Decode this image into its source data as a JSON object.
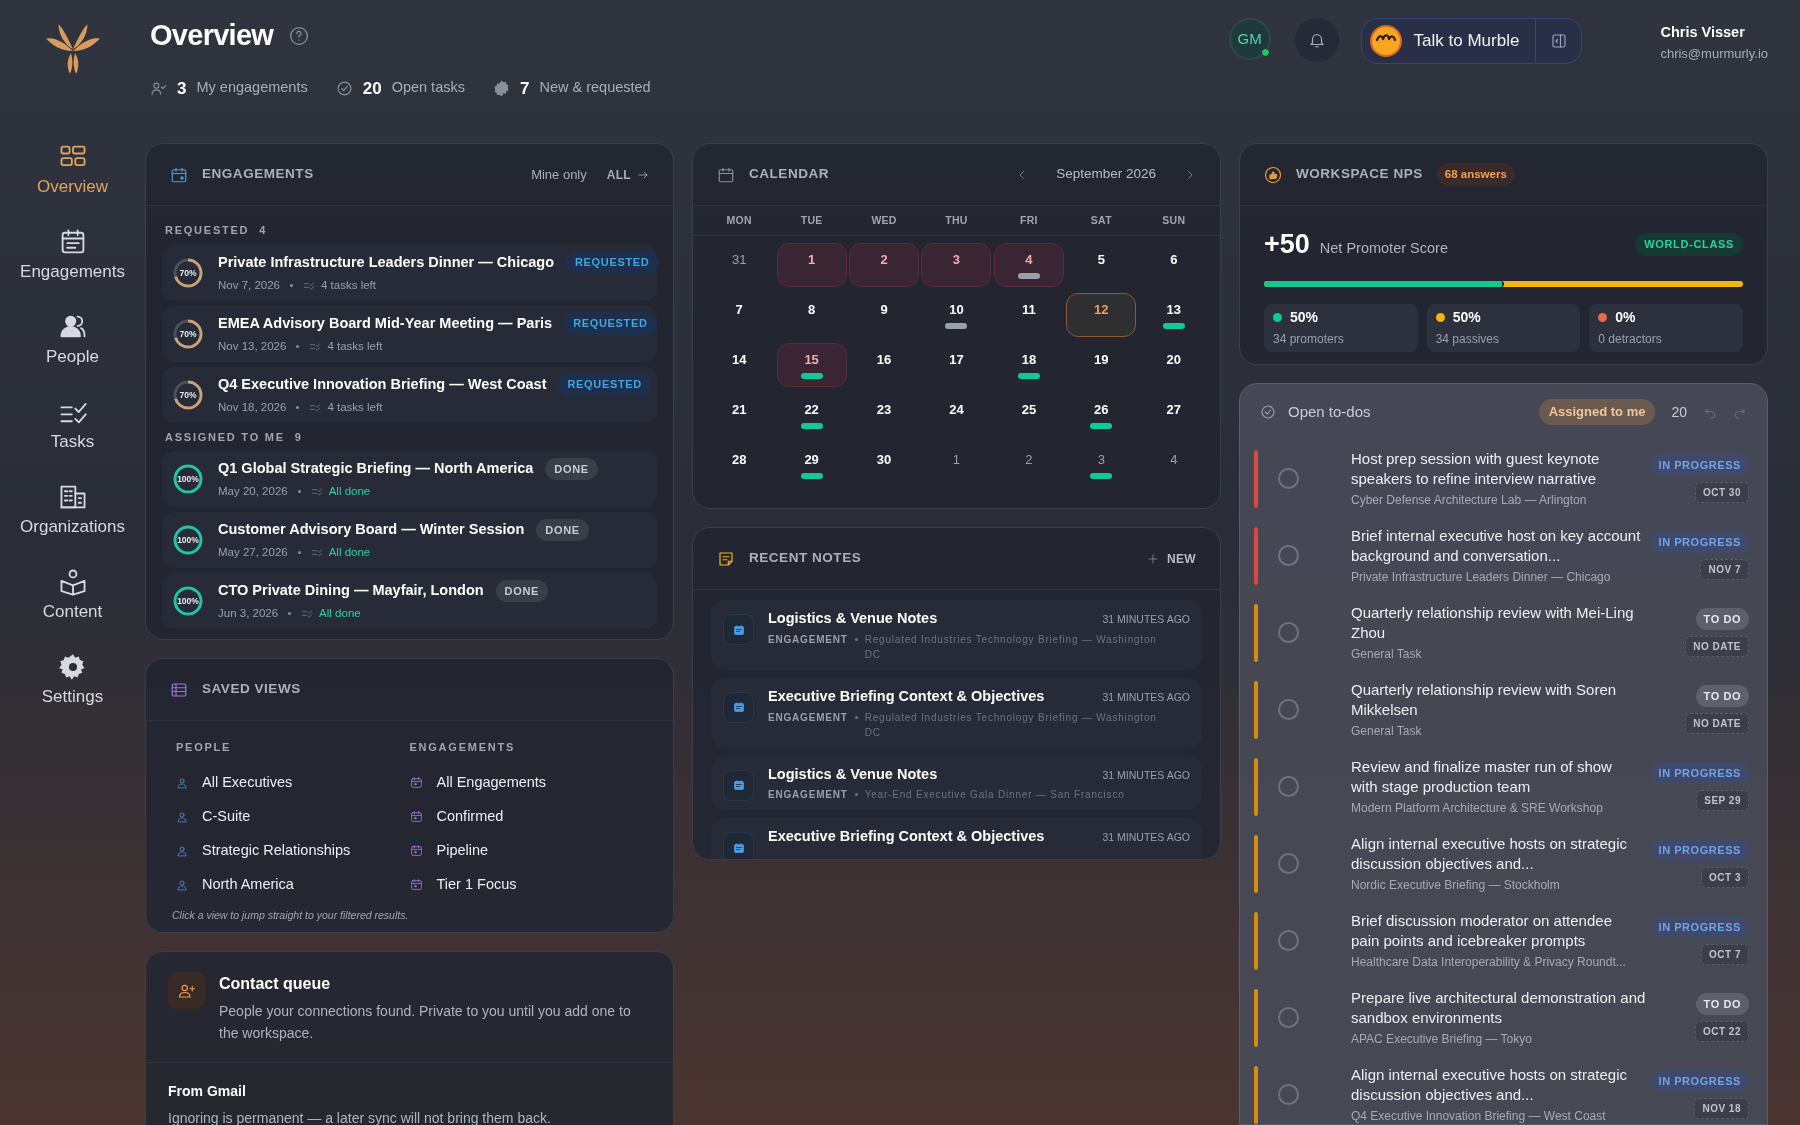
{
  "sidebar": {
    "items": [
      {
        "label": "Overview",
        "selected": true
      },
      {
        "label": "Engagements",
        "selected": false
      },
      {
        "label": "People",
        "selected": false
      },
      {
        "label": "Tasks",
        "selected": false
      },
      {
        "label": "Organizations",
        "selected": false
      },
      {
        "label": "Content",
        "selected": false
      },
      {
        "label": "Settings",
        "selected": false
      }
    ]
  },
  "header": {
    "title": "Overview",
    "stats": [
      {
        "value": "3",
        "label": "My engagements"
      },
      {
        "value": "20",
        "label": "Open tasks"
      },
      {
        "value": "7",
        "label": "New & requested"
      }
    ]
  },
  "topbar": {
    "avatar": "GM",
    "online": true,
    "assistant": "Talk to Murble",
    "user_name": "Chris Visser",
    "user_email": "chris@murmurly.io"
  },
  "engagements": {
    "title": "ENGAGEMENTS",
    "filter": "Mine only",
    "link": "ALL",
    "groups": [
      {
        "label": "REQUESTED",
        "count": "4",
        "items": [
          {
            "title": "Private Infrastructure Leaders Dinner — Chicago",
            "status": "REQUESTED",
            "kind": "requested",
            "progress": "70%",
            "level": 0.7,
            "date": "Nov 7, 2026",
            "tasks": "4 tasks left"
          },
          {
            "title": "EMEA Advisory Board Mid-Year Meeting — Paris",
            "status": "REQUESTED",
            "kind": "requested",
            "progress": "70%",
            "level": 0.7,
            "date": "Nov 13, 2026",
            "tasks": "4 tasks left"
          },
          {
            "title": "Q4 Executive Innovation Briefing — West Coast",
            "status": "REQUESTED",
            "kind": "requested",
            "progress": "70%",
            "level": 0.7,
            "date": "Nov 18, 2026",
            "tasks": "4 tasks left"
          }
        ]
      },
      {
        "label": "ASSIGNED TO ME",
        "count": "9",
        "items": [
          {
            "title": "Q1 Global Strategic Briefing — North America",
            "status": "DONE",
            "kind": "done",
            "progress": "100%",
            "level": 1,
            "date": "May 20, 2026",
            "tasks": "All done"
          },
          {
            "title": "Customer Advisory Board — Winter Session",
            "status": "DONE",
            "kind": "done",
            "progress": "100%",
            "level": 1,
            "date": "May 27, 2026",
            "tasks": "All done"
          },
          {
            "title": "CTO Private Dining — Mayfair, London",
            "status": "DONE",
            "kind": "done",
            "progress": "100%",
            "level": 1,
            "date": "Jun 3, 2026",
            "tasks": "All done"
          }
        ]
      }
    ]
  },
  "saved_views": {
    "title": "SAVED VIEWS",
    "columns": [
      {
        "heading": "PEOPLE",
        "kind": "people",
        "items": [
          "All Executives",
          "C-Suite",
          "Strategic Relationships",
          "North America"
        ]
      },
      {
        "heading": "ENGAGEMENTS",
        "kind": "engagements",
        "items": [
          "All Engagements",
          "Confirmed",
          "Pipeline",
          "Tier 1 Focus"
        ]
      }
    ],
    "hint": "Click a view to jump straight to your filtered results."
  },
  "contact_queue": {
    "title": "Contact queue",
    "description": "People your connections found. Private to you until you add one to the workspace.",
    "section_title": "From Gmail",
    "section_text": "Ignoring is permanent — a later sync will not bring them back."
  },
  "calendar": {
    "title": "CALENDAR",
    "month": "September 2026",
    "weekdays": [
      "MON",
      "TUE",
      "WED",
      "THU",
      "FRI",
      "SAT",
      "SUN"
    ],
    "days": [
      {
        "day": "31",
        "other_month": true,
        "event": false,
        "today": false
      },
      {
        "day": "1",
        "other_month": false,
        "event": true,
        "today": false
      },
      {
        "day": "2",
        "other_month": false,
        "event": true,
        "today": false
      },
      {
        "day": "3",
        "other_month": false,
        "event": true,
        "today": false
      },
      {
        "day": "4",
        "other_month": false,
        "event": true,
        "today": false,
        "color": "#9aa0ab"
      },
      {
        "day": "5",
        "other_month": false,
        "event": false,
        "today": false
      },
      {
        "day": "6",
        "other_month": false,
        "event": false,
        "today": false
      },
      {
        "day": "7",
        "other_month": false,
        "event": false,
        "today": false
      },
      {
        "day": "8",
        "other_month": false,
        "event": false,
        "today": false
      },
      {
        "day": "9",
        "other_month": false,
        "event": false,
        "today": false
      },
      {
        "day": "10",
        "other_month": false,
        "event": false,
        "today": false,
        "color": "#9aa0ab"
      },
      {
        "day": "11",
        "other_month": false,
        "event": false,
        "today": false
      },
      {
        "day": "12",
        "other_month": false,
        "event": false,
        "today": true
      },
      {
        "day": "13",
        "other_month": false,
        "event": false,
        "today": false,
        "color": "#10c99a"
      },
      {
        "day": "14",
        "other_month": false,
        "event": false,
        "today": false
      },
      {
        "day": "15",
        "other_month": false,
        "event": true,
        "today": false,
        "color": "#10c99a"
      },
      {
        "day": "16",
        "other_month": false,
        "event": false,
        "today": false
      },
      {
        "day": "17",
        "other_month": false,
        "event": false,
        "today": false
      },
      {
        "day": "18",
        "other_month": false,
        "event": false,
        "today": false,
        "color": "#10c99a"
      },
      {
        "day": "19",
        "other_month": false,
        "event": false,
        "today": false
      },
      {
        "day": "20",
        "other_month": false,
        "event": false,
        "today": false
      },
      {
        "day": "21",
        "other_month": false,
        "event": false,
        "today": false
      },
      {
        "day": "22",
        "other_month": false,
        "event": false,
        "today": false,
        "color": "#10c99a"
      },
      {
        "day": "23",
        "other_month": false,
        "event": false,
        "today": false
      },
      {
        "day": "24",
        "other_month": false,
        "event": false,
        "today": false
      },
      {
        "day": "25",
        "other_month": false,
        "event": false,
        "today": false
      },
      {
        "day": "26",
        "other_month": false,
        "event": false,
        "today": false,
        "color": "#10c99a"
      },
      {
        "day": "27",
        "other_month": false,
        "event": false,
        "today": false
      },
      {
        "day": "28",
        "other_month": false,
        "event": false,
        "today": false
      },
      {
        "day": "29",
        "other_month": false,
        "event": false,
        "today": false,
        "color": "#10c99a"
      },
      {
        "day": "30",
        "other_month": false,
        "event": false,
        "today": false
      },
      {
        "day": "1",
        "other_month": true,
        "event": false,
        "today": false
      },
      {
        "day": "2",
        "other_month": true,
        "event": false,
        "today": false
      },
      {
        "day": "3",
        "other_month": true,
        "event": false,
        "today": false,
        "color": "#10c99a"
      },
      {
        "day": "4",
        "other_month": true,
        "event": false,
        "today": false
      }
    ]
  },
  "recent_notes": {
    "title": "RECENT NOTES",
    "action": "NEW",
    "items": [
      {
        "title": "Logistics & Venue Notes",
        "time": "31 MINUTES AGO",
        "type": "ENGAGEMENT",
        "context": "Regulated Industries Technology Briefing — Washington DC"
      },
      {
        "title": "Executive Briefing Context & Objectives",
        "time": "31 MINUTES AGO",
        "type": "ENGAGEMENT",
        "context": "Regulated Industries Technology Briefing — Washington DC"
      },
      {
        "title": "Logistics & Venue Notes",
        "time": "31 MINUTES AGO",
        "type": "ENGAGEMENT",
        "context": "Year-End Executive Gala Dinner — San Francisco"
      },
      {
        "title": "Executive Briefing Context & Objectives",
        "time": "31 MINUTES AGO"
      }
    ]
  },
  "nps": {
    "title": "WORKSPACE NPS",
    "answers": "68 answers",
    "score": "+50",
    "label": "Net Promoter Score",
    "rating": "WORLD-CLASS",
    "bar": {
      "level": 0.5,
      "color": "#10c98f"
    },
    "stats": [
      {
        "value": "50%",
        "label": "34 promoters",
        "color": "#10c98f"
      },
      {
        "value": "50%",
        "label": "34 passives",
        "color": "#f5b50a"
      },
      {
        "value": "0%",
        "label": "0 detractors",
        "color": "#e86a4a"
      }
    ]
  },
  "todos": {
    "title": "Open to-dos",
    "filter": "Assigned to me",
    "count": "20",
    "items": [
      {
        "title": "Host prep session with guest keynote speakers to refine interview narrative",
        "context": "Cyber Defense Architecture Lab — Arlington",
        "status": "IN PROGRESS",
        "kind": "in_progress",
        "due": "OCT 30",
        "color": "#d9483f",
        "checked": false
      },
      {
        "title": "Brief internal executive host on key account background and conversation...",
        "context": "Private Infrastructure Leaders Dinner — Chicago",
        "status": "IN PROGRESS",
        "kind": "in_progress",
        "due": "NOV 7",
        "color": "#d9483f",
        "checked": false
      },
      {
        "title": "Quarterly relationship review with Mei-Ling Zhou",
        "context": "General Task",
        "status": "TO DO",
        "kind": "todo",
        "due": "NO DATE",
        "color": "#d98c0b",
        "checked": false
      },
      {
        "title": "Quarterly relationship review with Soren Mikkelsen",
        "context": "General Task",
        "status": "TO DO",
        "kind": "todo",
        "due": "NO DATE",
        "color": "#d98c0b",
        "checked": false
      },
      {
        "title": "Review and finalize master run of show with stage production team",
        "context": "Modern Platform Architecture & SRE Workshop",
        "status": "IN PROGRESS",
        "kind": "in_progress",
        "due": "SEP 29",
        "color": "#d98c0b",
        "checked": false
      },
      {
        "title": "Align internal executive hosts on strategic discussion objectives and...",
        "context": "Nordic Executive Briefing — Stockholm",
        "status": "IN PROGRESS",
        "kind": "in_progress",
        "due": "OCT 3",
        "color": "#d98c0b",
        "checked": false
      },
      {
        "title": "Brief discussion moderator on attendee pain points and icebreaker prompts",
        "context": "Healthcare Data Interoperability & Privacy Roundt...",
        "status": "IN PROGRESS",
        "kind": "in_progress",
        "due": "OCT 7",
        "color": "#d98c0b",
        "checked": false
      },
      {
        "title": "Prepare live architectural demonstration and sandbox environments",
        "context": "APAC Executive Briefing — Tokyo",
        "status": "TO DO",
        "kind": "todo",
        "due": "OCT 22",
        "color": "#d98c0b",
        "checked": false
      },
      {
        "title": "Align internal executive hosts on strategic discussion objectives and...",
        "context": "Q4 Executive Innovation Briefing — West Coast",
        "status": "IN PROGRESS",
        "kind": "in_progress",
        "due": "NOV 18",
        "color": "#d98c0b",
        "checked": false
      }
    ]
  }
}
